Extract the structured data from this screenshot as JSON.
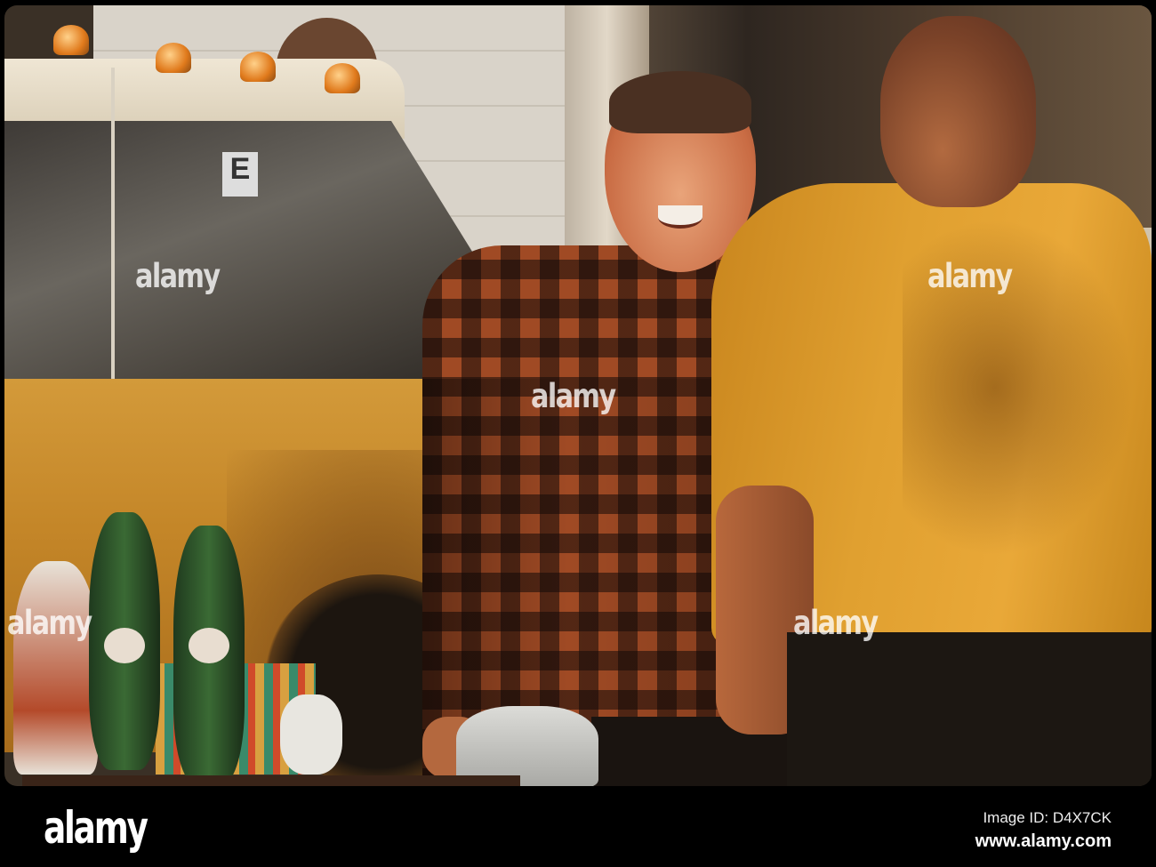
{
  "watermark": {
    "text": "alamy"
  },
  "footer": {
    "logo": "alamy",
    "image_id": "Image ID: D4X7CK",
    "website": "www.alamy.com"
  },
  "photo_sign_letter": "E",
  "colors": {
    "car": "#c48628",
    "plaid": "#a04a24",
    "yellow_shirt": "#e0a030",
    "bar": "#000000"
  }
}
